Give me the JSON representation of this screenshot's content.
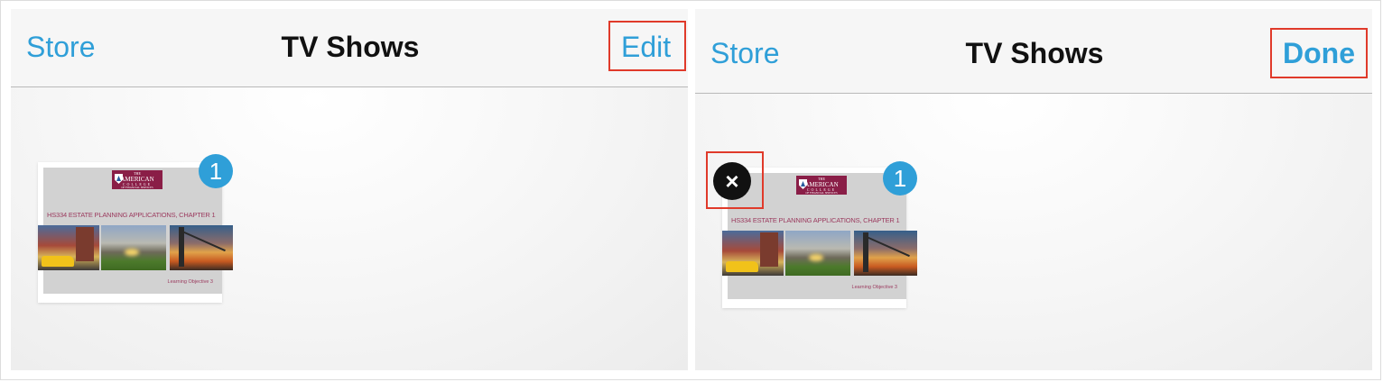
{
  "left_panel": {
    "nav": {
      "store": "Store",
      "title": "TV Shows",
      "action": "Edit"
    },
    "item": {
      "badge": "1",
      "slide": {
        "logo_line1": "THE",
        "logo_line2": "AMERICAN",
        "logo_line3": "COLLEGE",
        "logo_line4": "OF FINANCIAL SERVICES",
        "title": "HS334 ESTATE PLANNING APPLICATIONS, CHAPTER 1",
        "footer": "Learning Objective 3"
      }
    }
  },
  "right_panel": {
    "nav": {
      "store": "Store",
      "title": "TV Shows",
      "action": "Done"
    },
    "item": {
      "badge": "1",
      "delete_symbol": "×",
      "slide": {
        "logo_line1": "THE",
        "logo_line2": "AMERICAN",
        "logo_line3": "COLLEGE",
        "logo_line4": "OF FINANCIAL SERVICES",
        "title": "HS334 ESTATE PLANNING APPLICATIONS, CHAPTER 1",
        "footer": "Learning Objective 3"
      }
    }
  },
  "colors": {
    "accent": "#2f9fd8",
    "highlight": "#e03a2a",
    "slide_brand": "#8a1e47"
  }
}
